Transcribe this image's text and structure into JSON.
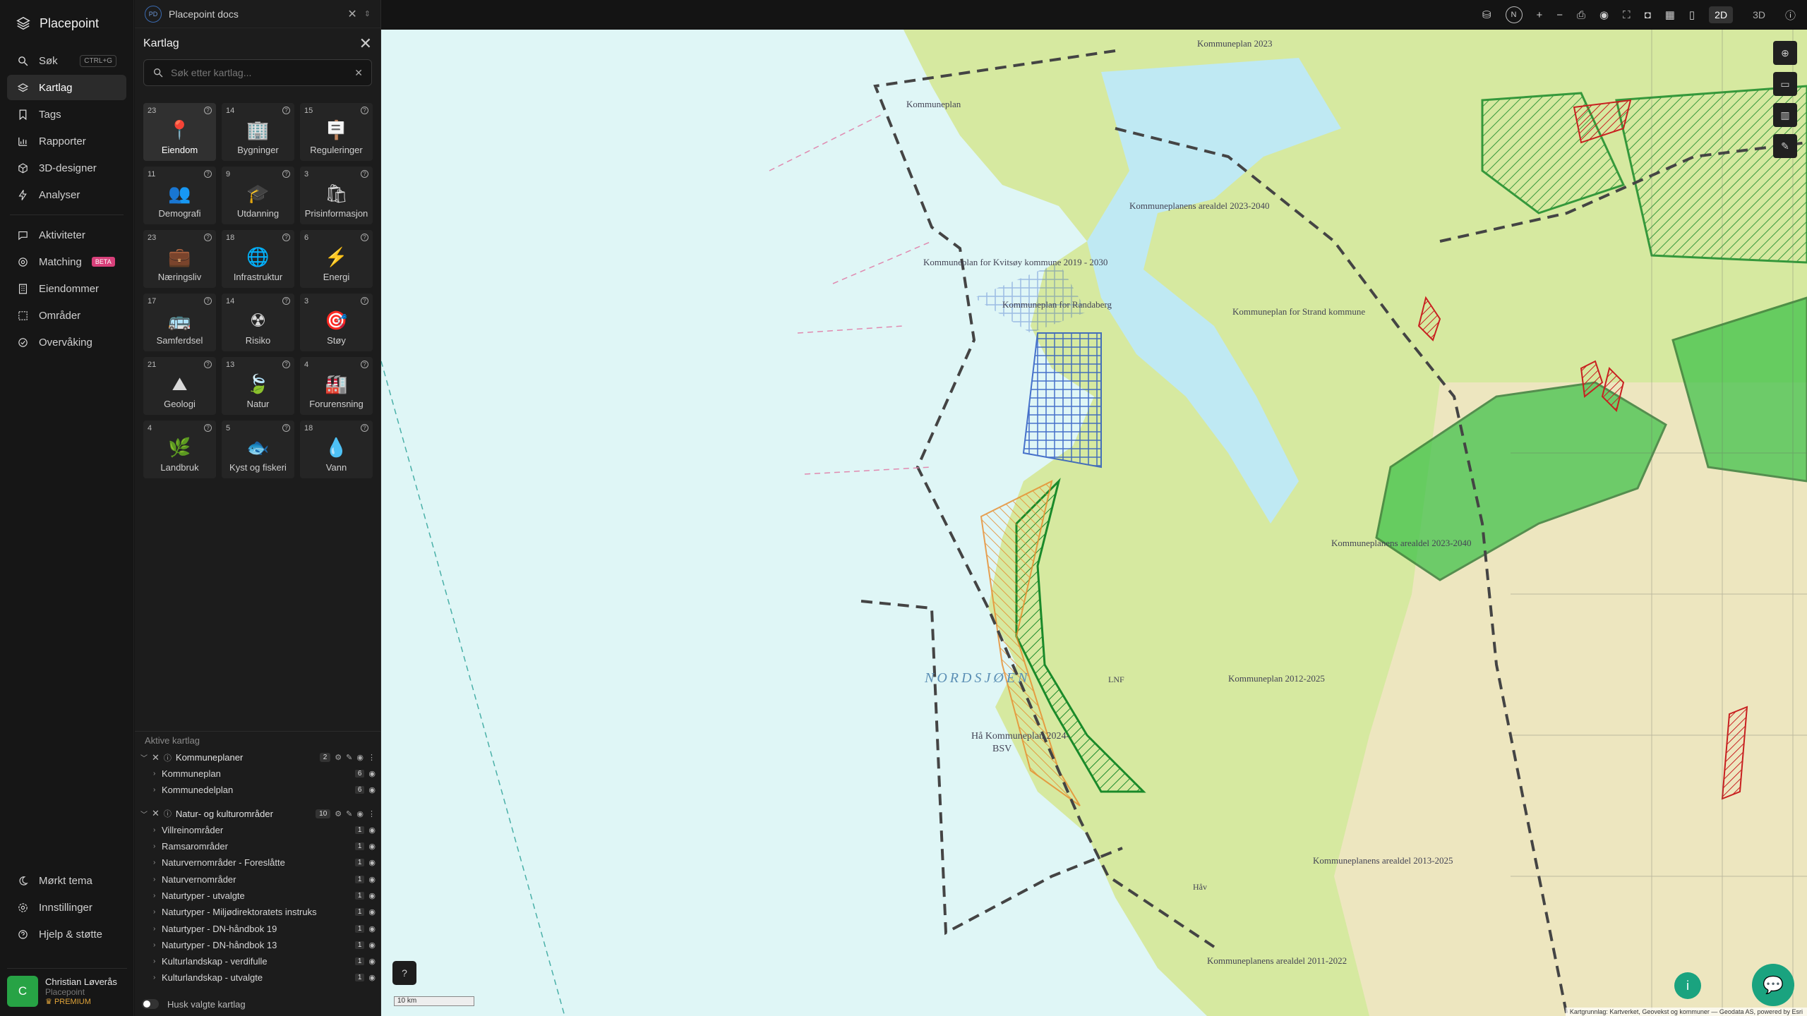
{
  "brand": {
    "name": "Placepoint"
  },
  "nav": {
    "items": [
      {
        "label": "Søk",
        "shortcut": "CTRL+G"
      },
      {
        "label": "Kartlag"
      },
      {
        "label": "Tags"
      },
      {
        "label": "Rapporter"
      },
      {
        "label": "3D-designer"
      },
      {
        "label": "Analyser"
      },
      {
        "label": "Aktiviteter"
      },
      {
        "label": "Matching",
        "badge": "BETA"
      },
      {
        "label": "Eiendommer"
      },
      {
        "label": "Områder"
      },
      {
        "label": "Overvåking"
      }
    ],
    "bottom": [
      {
        "label": "Mørkt tema"
      },
      {
        "label": "Innstillinger"
      },
      {
        "label": "Hjelp & støtte"
      }
    ]
  },
  "user": {
    "initial": "C",
    "name": "Christian Løverås",
    "org": "Placepoint",
    "plan": "PREMIUM"
  },
  "doc_tab": {
    "badge": "PD",
    "title": "Placepoint docs"
  },
  "panel": {
    "title": "Kartlag",
    "search_placeholder": "Søk etter kartlag...",
    "categories": [
      {
        "count": "23",
        "label": "Eiendom",
        "icon": "📍"
      },
      {
        "count": "14",
        "label": "Bygninger",
        "icon": "🏢"
      },
      {
        "count": "15",
        "label": "Reguleringer",
        "icon": "🪧"
      },
      {
        "count": "11",
        "label": "Demografi",
        "icon": "👥"
      },
      {
        "count": "9",
        "label": "Utdanning",
        "icon": "🎓"
      },
      {
        "count": "3",
        "label": "Prisinformasjon",
        "icon": "🛍"
      },
      {
        "count": "23",
        "label": "Næringsliv",
        "icon": "💼"
      },
      {
        "count": "18",
        "label": "Infrastruktur",
        "icon": "🌐"
      },
      {
        "count": "6",
        "label": "Energi",
        "icon": "⚡"
      },
      {
        "count": "17",
        "label": "Samferdsel",
        "icon": "🚌"
      },
      {
        "count": "14",
        "label": "Risiko",
        "icon": "☢"
      },
      {
        "count": "3",
        "label": "Støy",
        "icon": "🎯"
      },
      {
        "count": "21",
        "label": "Geologi",
        "icon": "⛰"
      },
      {
        "count": "13",
        "label": "Natur",
        "icon": "🍃"
      },
      {
        "count": "4",
        "label": "Forurensning",
        "icon": "🏭"
      },
      {
        "count": "4",
        "label": "Landbruk",
        "icon": "🌿"
      },
      {
        "count": "5",
        "label": "Kyst og fiskeri",
        "icon": "🐟"
      },
      {
        "count": "18",
        "label": "Vann",
        "icon": "💧"
      }
    ],
    "active_heading": "Aktive kartlag",
    "groups": [
      {
        "label": "Kommuneplaner",
        "count": "2",
        "layers": [
          {
            "label": "Kommuneplan",
            "count": "6"
          },
          {
            "label": "Kommunedelplan",
            "count": "6"
          }
        ]
      },
      {
        "label": "Natur- og kulturområder",
        "count": "10",
        "layers": [
          {
            "label": "Villreinområder",
            "count": "1"
          },
          {
            "label": "Ramsarområder",
            "count": "1"
          },
          {
            "label": "Naturvernområder - Foreslåtte",
            "count": "1"
          },
          {
            "label": "Naturvernområder",
            "count": "1"
          },
          {
            "label": "Naturtyper - utvalgte",
            "count": "1"
          },
          {
            "label": "Naturtyper - Miljødirektoratets instruks",
            "count": "1"
          },
          {
            "label": "Naturtyper - DN-håndbok 19",
            "count": "1"
          },
          {
            "label": "Naturtyper - DN-håndbok 13",
            "count": "1"
          },
          {
            "label": "Kulturlandskap - verdifulle",
            "count": "1"
          },
          {
            "label": "Kulturlandskap - utvalgte",
            "count": "1"
          }
        ]
      }
    ],
    "remember_label": "Husk valgte kartlag"
  },
  "toolbar": {
    "north": "N",
    "zoom_in": "+",
    "zoom_out": "−",
    "mode_2d": "2D",
    "mode_3d": "3D"
  },
  "map": {
    "labels": {
      "sea": "NORDSJØEN",
      "ha_plan": "Hå Kommuneplan 2024-",
      "bsv": "BSV",
      "kvitsoy": "Kommuneplan for Kvitsøy kommune 2019 - 2030",
      "randaberg": "Kommuneplan for Randaberg",
      "stavanger": "Kommuneplanens arealdel 2023-2040",
      "strand": "Kommuneplan for Strand kommune",
      "kommuneplan": "Kommuneplan",
      "kp2023": "Kommuneplan 2023",
      "arealdel2040": "Kommuneplanens arealdel 2023-2040",
      "kp2012": "Kommuneplan 2012-2025",
      "arealdel2013": "Kommuneplanens arealdel 2013-2025",
      "arealdel2011": "Kommuneplanens arealdel 2011-2022",
      "haav": "Håv",
      "lnf": "LNF",
      "scale": "10 km"
    },
    "attribution": "Kartgrunnlag: Kartverket, Geovekst og kommuner — Geodata AS, powered by Esri"
  },
  "colors": {
    "accent": "#1aa37f",
    "avatar": "#27a345",
    "beta": "#d8407a",
    "premium": "#e0a43a",
    "sea": "#dff6f6",
    "land": "#d6e9a0"
  }
}
